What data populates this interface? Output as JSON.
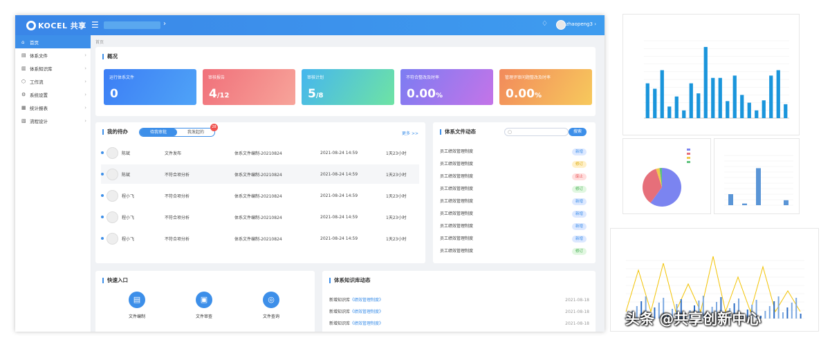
{
  "header": {
    "logo": "KOCEL 共享",
    "user": "zhaopeng3"
  },
  "sidebar": {
    "items": [
      {
        "icon": "home-icon",
        "glyph": "⌂",
        "label": "首页"
      },
      {
        "icon": "doc-icon",
        "glyph": "▤",
        "label": "体系文件"
      },
      {
        "icon": "library-icon",
        "glyph": "▥",
        "label": "体系知识库"
      },
      {
        "icon": "workflow-icon",
        "glyph": "⬡",
        "label": "工作流"
      },
      {
        "icon": "settings-icon",
        "glyph": "⚙",
        "label": "系统设置"
      },
      {
        "icon": "report-icon",
        "glyph": "▦",
        "label": "统计报表"
      },
      {
        "icon": "design-icon",
        "glyph": "▧",
        "label": "流程设计"
      }
    ]
  },
  "breadcrumb": "首页",
  "overview": {
    "title": "概况",
    "stats": [
      {
        "label": "运行体系文件",
        "value": "0",
        "suffix": ""
      },
      {
        "label": "审核报告",
        "value": "4",
        "suffix": "/12"
      },
      {
        "label": "审核计划",
        "value": "5",
        "suffix": "/8"
      },
      {
        "label": "不符合整改及时率",
        "value": "0.00",
        "suffix": "%"
      },
      {
        "label": "管理评审问题整改及时率",
        "value": "0.00",
        "suffix": "%"
      }
    ]
  },
  "tasks": {
    "title": "我的待办",
    "tab1": "待我审批",
    "tab2": "我发起的",
    "badge": "28",
    "more": "更多 >>",
    "rows": [
      {
        "name": "陈斌",
        "action": "文件发布",
        "doc": "体系文件编制-20210824",
        "time": "2021-08-24 14:59",
        "ago": "1天23小时"
      },
      {
        "name": "陈斌",
        "action": "不符合项分析",
        "doc": "体系文件编制-20210824",
        "time": "2021-08-24 14:59",
        "ago": "1天23小时"
      },
      {
        "name": "程小飞",
        "action": "不符合项分析",
        "doc": "体系文件编制-20210824",
        "time": "2021-08-24 14:59",
        "ago": "1天23小时"
      },
      {
        "name": "程小飞",
        "action": "不符合项分析",
        "doc": "体系文件编制-20210824",
        "time": "2021-08-24 14:59",
        "ago": "1天23小时"
      },
      {
        "name": "程小飞",
        "action": "不符合项分析",
        "doc": "体系文件编制-20210824",
        "time": "2021-08-24 14:59",
        "ago": "1天23小时"
      }
    ]
  },
  "dynamics": {
    "title": "体系文件动态",
    "button": "搜索",
    "rows": [
      {
        "name": "员工绩效管理制度",
        "status": "新增",
        "color": "#dce8ff",
        "text": "#3d8fe9"
      },
      {
        "name": "员工绩效管理制度",
        "status": "修订",
        "color": "#fff0c8",
        "text": "#d9a400"
      },
      {
        "name": "员工绩效管理制度",
        "status": "废止",
        "color": "#ffdede",
        "text": "#e85555"
      },
      {
        "name": "员工绩效管理制度",
        "status": "修订",
        "color": "#e1f7e1",
        "text": "#39a845"
      },
      {
        "name": "员工绩效管理制度",
        "status": "新增",
        "color": "#dce8ff",
        "text": "#3d8fe9"
      },
      {
        "name": "员工绩效管理制度",
        "status": "新增",
        "color": "#dce8ff",
        "text": "#3d8fe9"
      },
      {
        "name": "员工绩效管理制度",
        "status": "新增",
        "color": "#dce8ff",
        "text": "#3d8fe9"
      },
      {
        "name": "员工绩效管理制度",
        "status": "新增",
        "color": "#dce8ff",
        "text": "#3d8fe9"
      },
      {
        "name": "员工绩效管理制度",
        "status": "修订",
        "color": "#e1f7e1",
        "text": "#39a845"
      }
    ]
  },
  "quick": {
    "title": "快速入口",
    "items": [
      {
        "icon": "doc-edit-icon",
        "glyph": "▤",
        "label": "文件编制"
      },
      {
        "icon": "doc-review-icon",
        "glyph": "▣",
        "label": "文件审查"
      },
      {
        "icon": "doc-search-icon",
        "glyph": "◎",
        "label": "文件查询"
      }
    ]
  },
  "knowledge": {
    "title": "体系知识库动态",
    "rows": [
      {
        "text": "新增知识库",
        "link": "《绩效管理制度》",
        "date": "2021-08-18"
      },
      {
        "text": "新增知识库",
        "link": "《绩效管理制度》",
        "date": "2021-08-18"
      },
      {
        "text": "新增知识库",
        "link": "《绩效管理制度》",
        "date": "2021-08-18"
      }
    ]
  },
  "watermark": "头条 @共享创新中心",
  "chart_data": [
    {
      "type": "bar",
      "values": [
        45,
        38,
        62,
        15,
        28,
        10,
        45,
        32,
        92,
        52,
        52,
        22,
        55,
        30,
        20,
        10,
        23,
        55,
        62,
        18
      ],
      "ylim": [
        0,
        100
      ]
    },
    {
      "type": "pie",
      "values": [
        60,
        35,
        3,
        2
      ]
    },
    {
      "type": "bar",
      "values": [
        20,
        3,
        67,
        0,
        9
      ],
      "ylim": [
        0,
        90
      ]
    }
  ]
}
